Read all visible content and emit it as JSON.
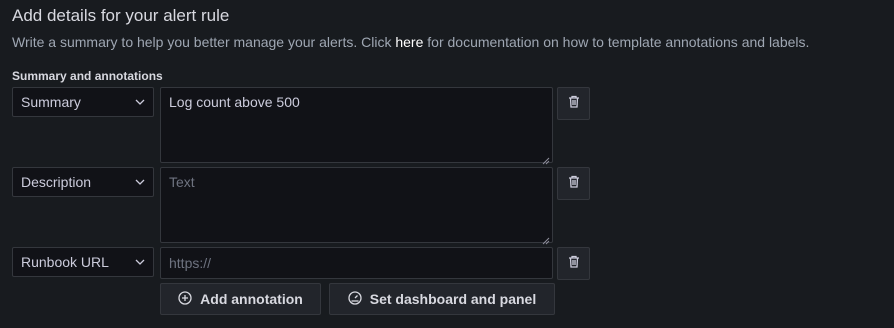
{
  "header": {
    "title": "Add details for your alert rule",
    "subtitle_before": "Write a summary to help you better manage your alerts. Click ",
    "subtitle_link": "here",
    "subtitle_after": " for documentation on how to template annotations and labels."
  },
  "section_label": "Summary and annotations",
  "annotations": [
    {
      "key": "Summary",
      "value": "Log count above 500",
      "placeholder": ""
    },
    {
      "key": "Description",
      "value": "",
      "placeholder": "Text"
    },
    {
      "key": "Runbook URL",
      "value": "",
      "placeholder": "https://"
    }
  ],
  "buttons": {
    "add_annotation": "Add annotation",
    "set_dashboard": "Set dashboard and panel"
  },
  "icons": {
    "select": "chevron-down-icon",
    "delete": "trash-icon",
    "add": "plus-circle-icon",
    "dashboard": "dashboard-icon"
  }
}
